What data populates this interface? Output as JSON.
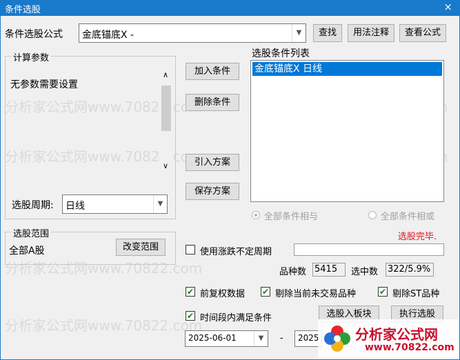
{
  "window": {
    "title": "条件选股",
    "close_glyph": "×"
  },
  "formula": {
    "label": "条件选股公式",
    "value": "金底锚底X  -",
    "find_button": "查找",
    "usage_button": "用法注释",
    "view_button": "查看公式"
  },
  "params": {
    "legend": "计算参数",
    "text": "无参数需要设置",
    "period_label": "选股周期:",
    "period_value": "日线"
  },
  "actions": {
    "add": "加入条件",
    "delete": "删除条件",
    "import": "引入方案",
    "save": "保存方案"
  },
  "conditions": {
    "label": "选股条件列表",
    "items": [
      "金底锚底X  日线"
    ],
    "radio_and": "全部条件相与",
    "radio_or": "全部条件相或",
    "status": "选股完毕."
  },
  "scope": {
    "legend": "选股范围",
    "text": "全部A股",
    "change_button": "改变范围"
  },
  "options": {
    "use_period_label": "使用涨跌不定周期",
    "count_label": "品种数",
    "count_value": "5415",
    "selected_label": "选中数",
    "selected_value": "322/5.9%",
    "fq_label": "前复权数据",
    "exclude_untraded_label": "剔除当前未交易品种",
    "exclude_st_label": "剔除ST品种",
    "time_range_label": "时间段内满足条件",
    "to_block_button": "选股入板块",
    "execute_button": "执行选股",
    "date_from": "2025-06-01",
    "date_sep": "-",
    "date_to": "2025"
  },
  "watermark": {
    "line1": "分析家公式网www.70822.com",
    "logo_text": "分析家公式网",
    "logo_url": "www.70822.com"
  },
  "colors": {
    "title_bar": "#1979ca",
    "selection": "#0078d7",
    "status_red": "#e0141e",
    "logo_red": "#c8102e"
  }
}
